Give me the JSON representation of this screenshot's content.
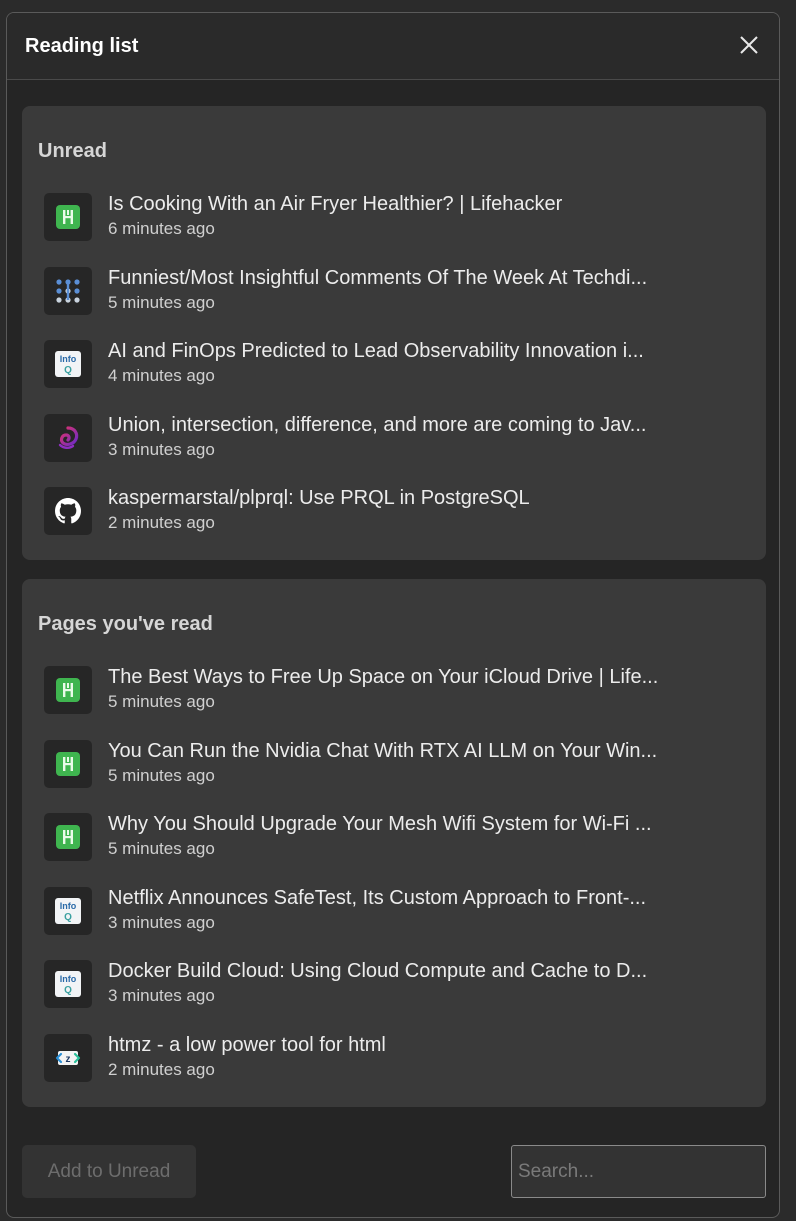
{
  "header": {
    "title": "Reading list",
    "close_icon": "close-icon"
  },
  "unread": {
    "heading": "Unread",
    "items": [
      {
        "title": "Is Cooking With an Air Fryer Healthier? | Lifehacker",
        "time": "6 minutes ago",
        "icon": "lifehacker-icon"
      },
      {
        "title": "Funniest/Most Insightful Comments Of The Week At Techdi...",
        "time": "5 minutes ago",
        "icon": "techdirt-icon"
      },
      {
        "title": "AI and FinOps Predicted to Lead Observability Innovation i...",
        "time": "4 minutes ago",
        "icon": "infoq-icon"
      },
      {
        "title": "Union, intersection, difference, and more are coming to Jav...",
        "time": "3 minutes ago",
        "icon": "spiral-icon"
      },
      {
        "title": "kaspermarstal/plprql: Use PRQL in PostgreSQL",
        "time": "2 minutes ago",
        "icon": "github-icon"
      }
    ]
  },
  "read": {
    "heading": "Pages you've read",
    "items": [
      {
        "title": "The Best Ways to Free Up Space on Your iCloud Drive | Life...",
        "time": "5 minutes ago",
        "icon": "lifehacker-icon"
      },
      {
        "title": "You Can Run the Nvidia Chat With RTX AI LLM on Your Win...",
        "time": "5 minutes ago",
        "icon": "lifehacker-icon"
      },
      {
        "title": "Why You Should Upgrade Your Mesh Wifi System for Wi-Fi ...",
        "time": "5 minutes ago",
        "icon": "lifehacker-icon"
      },
      {
        "title": "Netflix Announces SafeTest, Its Custom Approach to Front-...",
        "time": "3 minutes ago",
        "icon": "infoq-icon"
      },
      {
        "title": "Docker Build Cloud: Using Cloud Compute and Cache to D...",
        "time": "3 minutes ago",
        "icon": "infoq-icon"
      },
      {
        "title": "htmz - a low power tool for html",
        "time": "2 minutes ago",
        "icon": "htmz-icon"
      }
    ]
  },
  "footer": {
    "add_label": "Add to Unread",
    "search_placeholder": "Search..."
  },
  "colors": {
    "background": "#252525",
    "section": "#3a3a3a",
    "lifehacker_green": "#3fb54f"
  }
}
